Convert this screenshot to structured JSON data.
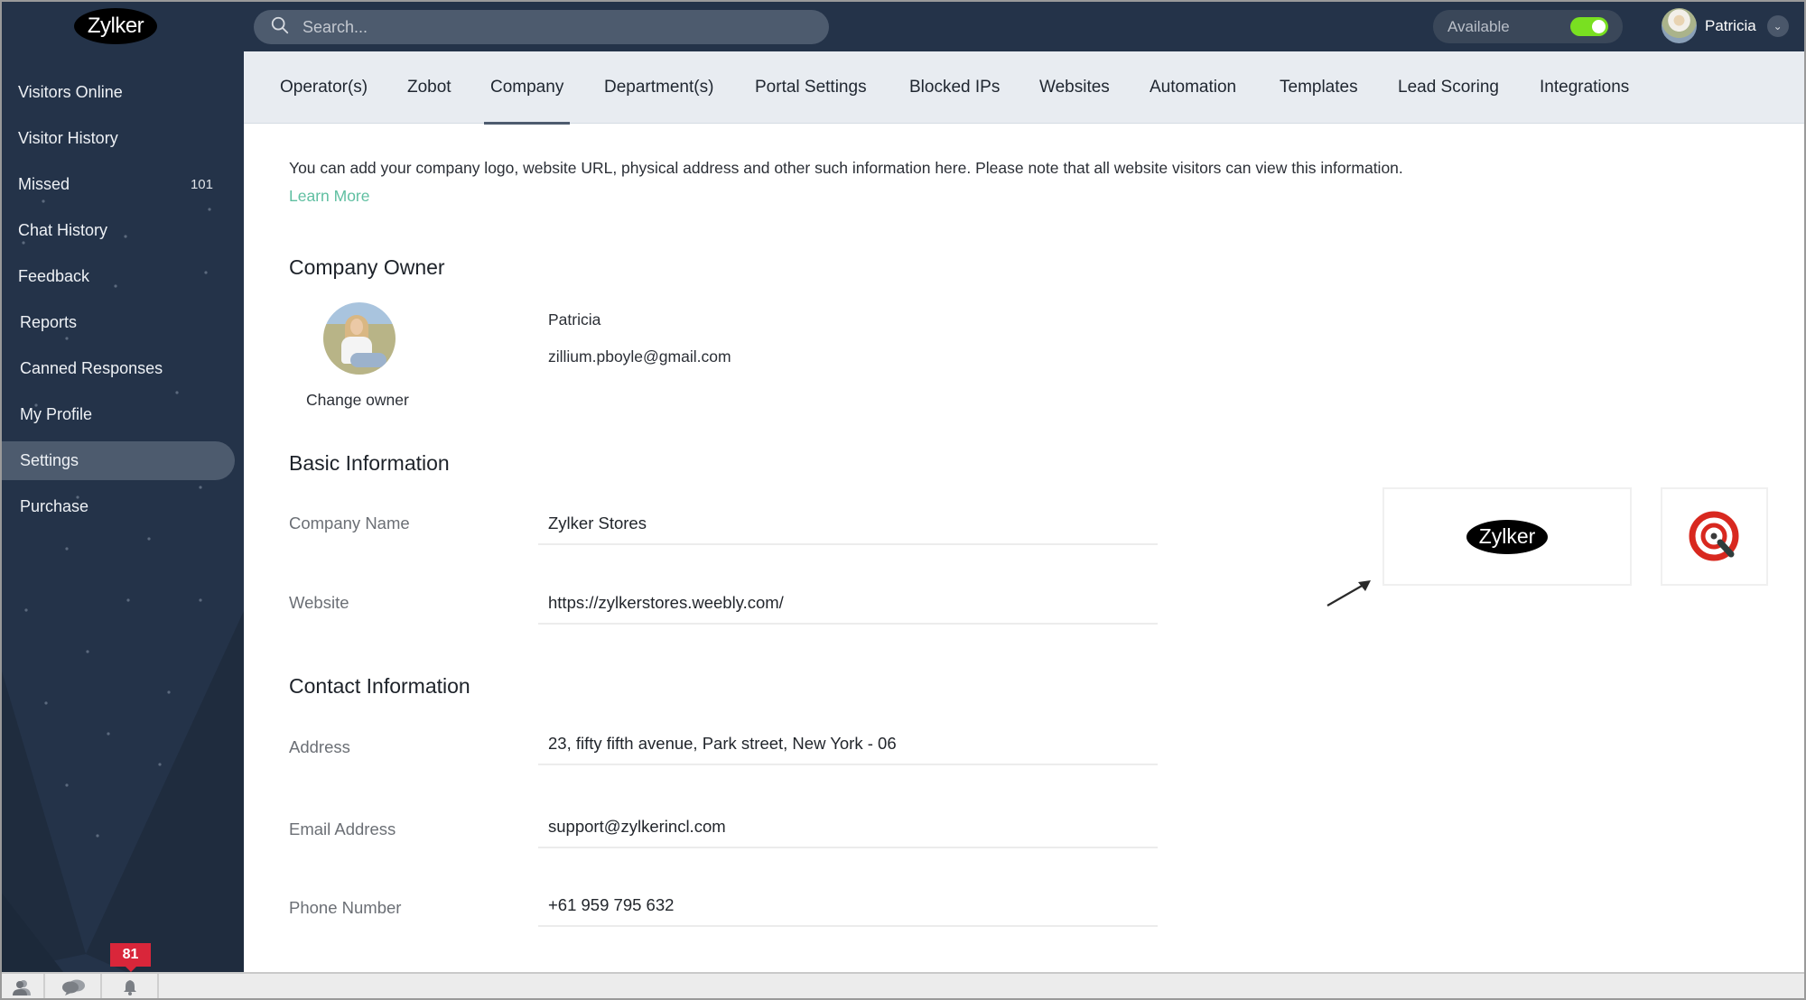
{
  "header": {
    "logo_text": "Zylker",
    "search_placeholder": "Search...",
    "status_label": "Available",
    "status_on": true,
    "status_color": "#79e021",
    "user_name": "Patricia"
  },
  "sidebar": {
    "items": [
      {
        "label": "Visitors Online"
      },
      {
        "label": "Visitor History"
      },
      {
        "label": "Missed",
        "count": "101"
      },
      {
        "label": "Chat History"
      },
      {
        "label": "Feedback"
      },
      {
        "label": "Reports"
      },
      {
        "label": "Canned Responses"
      },
      {
        "label": "My Profile"
      },
      {
        "label": "Settings",
        "active": true
      },
      {
        "label": "Purchase"
      }
    ]
  },
  "bottombar": {
    "notification_count": "81",
    "icons": [
      "visitors-icon",
      "chats-icon",
      "bell-icon"
    ]
  },
  "tabs": [
    {
      "label": "Operator(s)"
    },
    {
      "label": "Zobot"
    },
    {
      "label": "Company",
      "active": true
    },
    {
      "label": "Department(s)"
    },
    {
      "label": "Portal Settings"
    },
    {
      "label": "Blocked IPs"
    },
    {
      "label": "Websites"
    },
    {
      "label": "Automation"
    },
    {
      "label": "Templates"
    },
    {
      "label": "Lead Scoring"
    },
    {
      "label": "Integrations"
    }
  ],
  "content": {
    "intro_text": "You can add your company logo, website URL, physical address and other such information here. Please note that all website visitors can view this information.",
    "learn_more": "Learn More",
    "owner_section": {
      "title": "Company Owner",
      "change_owner": "Change owner",
      "name": "Patricia",
      "email": "zillium.pboyle@gmail.com"
    },
    "basic_section": {
      "title": "Basic Information",
      "fields": [
        {
          "label": "Company Name",
          "value": "Zylker Stores"
        },
        {
          "label": "Website",
          "value": "https://zylkerstores.weebly.com/"
        }
      ],
      "logo_text": "Zylker"
    },
    "contact_section": {
      "title": "Contact Information",
      "fields": [
        {
          "label": "Address",
          "value": "23, fifty fifth avenue, Park street, New York - 06"
        },
        {
          "label": "Email Address",
          "value": "support@zylkerincl.com"
        },
        {
          "label": "Phone Number",
          "value": "+61 959 795 632"
        }
      ]
    },
    "link_color": "#5fbfa1"
  }
}
